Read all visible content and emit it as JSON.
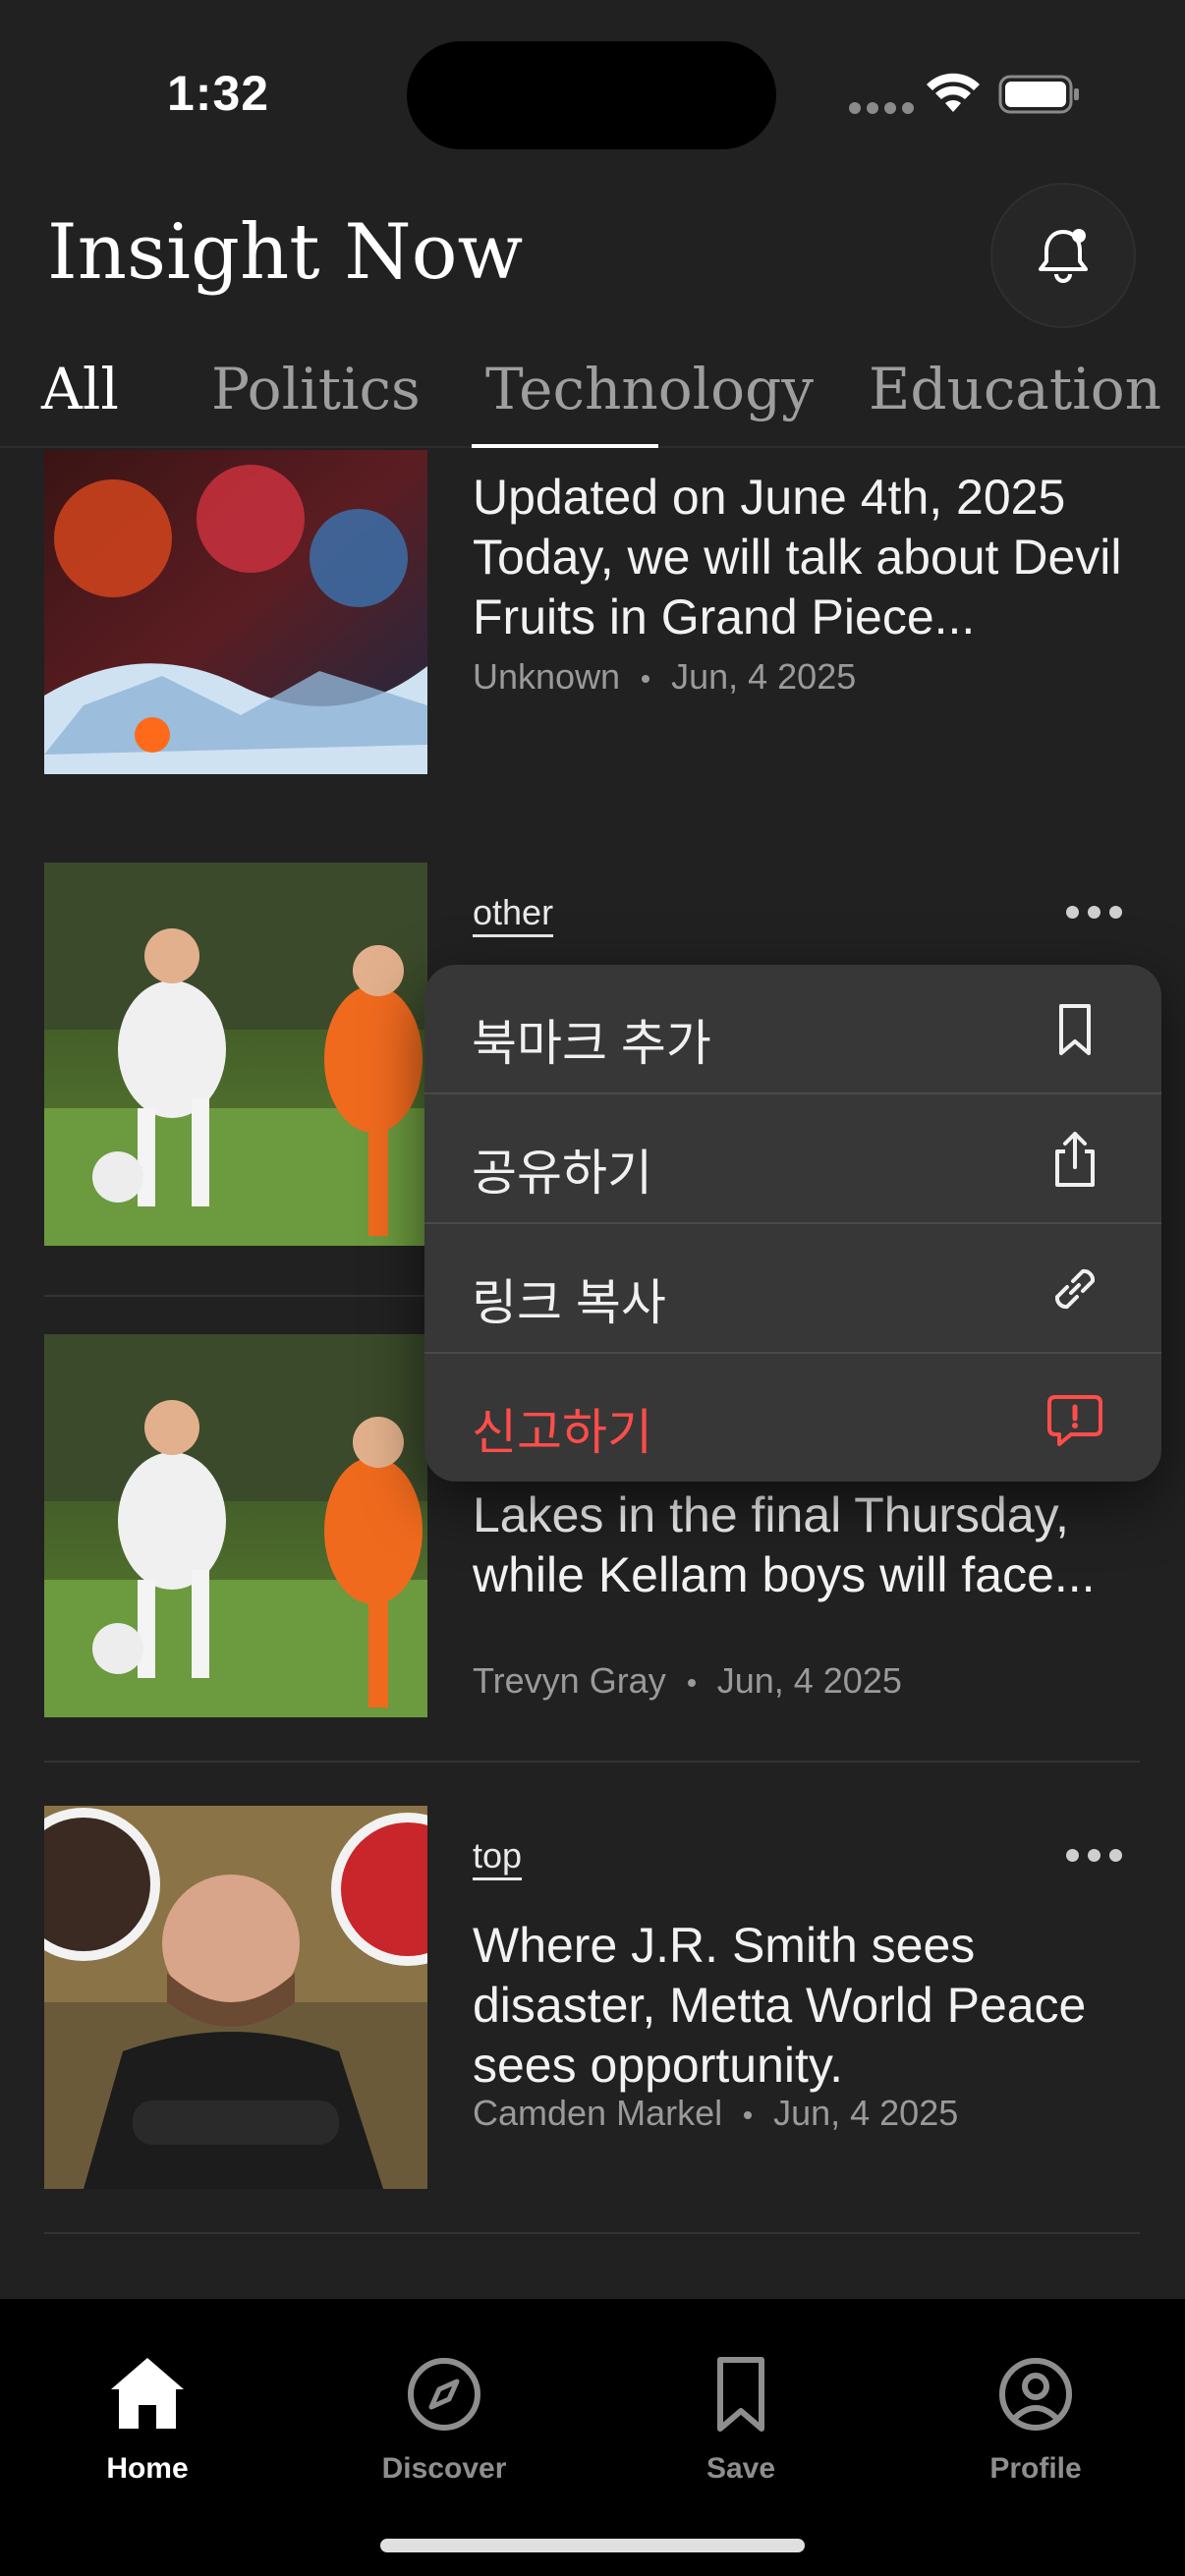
{
  "status": {
    "time": "1:32"
  },
  "header": {
    "title": "Insight Now"
  },
  "tabs": [
    {
      "label": "All",
      "active": true
    },
    {
      "label": "Politics",
      "active": false
    },
    {
      "label": "Technology",
      "active": false
    },
    {
      "label": "Education",
      "active": false
    }
  ],
  "articles": [
    {
      "category": "",
      "headline": "Updated on June 4th, 2025 Today, we will talk about Devil Fruits in Grand Piece...",
      "author": "Unknown",
      "date": "Jun, 4 2025",
      "thumbnail": "anime-battle-image"
    },
    {
      "category": "other",
      "headline": "",
      "author": "",
      "date": "",
      "thumbnail": "soccer-players-image"
    },
    {
      "category": "",
      "headline": "Lakes in the final Thursday, while Kellam boys will face...",
      "author": "Trevyn Gray",
      "date": "Jun, 4 2025",
      "thumbnail": "soccer-players-image"
    },
    {
      "category": "top",
      "headline": "Where J.R. Smith sees disaster, Metta World Peace sees opportunity.",
      "author": "Camden Markel",
      "date": "Jun, 4 2025",
      "thumbnail": "basketball-coach-image"
    }
  ],
  "menu": {
    "items": [
      {
        "label": "북마크 추가",
        "icon": "bookmark-icon"
      },
      {
        "label": "공유하기",
        "icon": "share-icon"
      },
      {
        "label": "링크 복사",
        "icon": "link-icon"
      },
      {
        "label": "신고하기",
        "icon": "report-icon",
        "color": "#ff4d4a"
      }
    ]
  },
  "nav": [
    {
      "label": "Home",
      "icon": "home-icon",
      "active": true
    },
    {
      "label": "Discover",
      "icon": "compass-icon",
      "active": false
    },
    {
      "label": "Save",
      "icon": "bookmark-icon",
      "active": false
    },
    {
      "label": "Profile",
      "icon": "profile-icon",
      "active": false
    }
  ],
  "colors": {
    "background": "#212121",
    "danger": "#ff4d4a",
    "nav_background": "#000000"
  }
}
